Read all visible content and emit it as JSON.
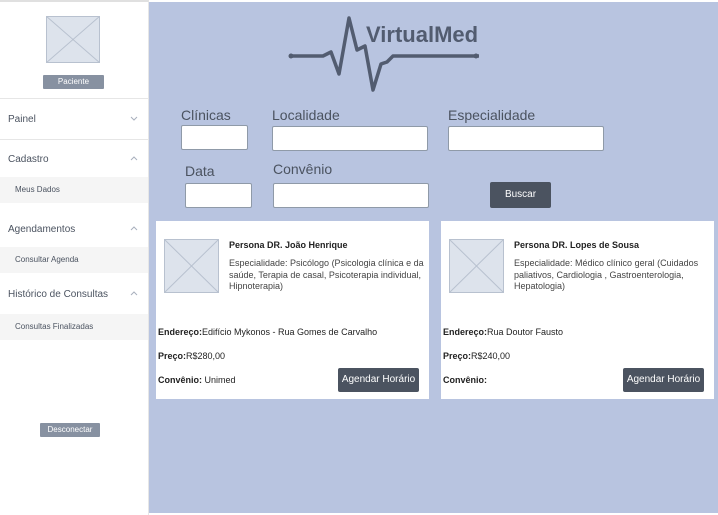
{
  "sidebar": {
    "profile_button": "Paciente",
    "logout_button": "Desconectar",
    "items": [
      {
        "label": "Painel"
      },
      {
        "label": "Cadastro",
        "subitems": [
          "Meus Dados"
        ]
      },
      {
        "label": "Agendamentos",
        "subitems": [
          "Consultar Agenda"
        ]
      },
      {
        "label": "Histórico de Consultas",
        "subitems": [
          "Consultas Finalizadas"
        ]
      }
    ]
  },
  "header": {
    "brand": "VirtualMed"
  },
  "search": {
    "clinicas_label": "Clínicas",
    "localidade_label": "Localidade",
    "especialidade_label": "Especialidade",
    "data_label": "Data",
    "convenio_label": "Convênio",
    "search_button": "Buscar"
  },
  "doctors": [
    {
      "name": "Persona DR. João Henrique",
      "specialty": "Especialidade: Psicólogo (Psicologia clínica e da saúde, Terapia de casal, Psicoterapia individual, Hipnoterapia)",
      "address_label": "Endereço:",
      "address": "Edifício Mykonos - Rua Gomes de Carvalho",
      "price_label": "Preço:",
      "price": "R$280,00",
      "insurance_label": "Convênio:",
      "insurance": " Unimed",
      "schedule_button": "Agendar Horário"
    },
    {
      "name": "Persona DR. Lopes de Sousa",
      "specialty": "Especialidade: Médico clínico geral (Cuidados paliativos, Cardiologia , Gastroenterologia, Hepatologia)",
      "address_label": "Endereço:",
      "address": "Rua Doutor Fausto",
      "price_label": "Preço:",
      "price": "R$240,00",
      "insurance_label": "Convênio:",
      "insurance": "",
      "schedule_button": "Agendar Horário"
    }
  ],
  "colors": {
    "main_bg": "#b8c4e0",
    "dark_button": "#4b5360",
    "small_button": "#8791a1"
  }
}
